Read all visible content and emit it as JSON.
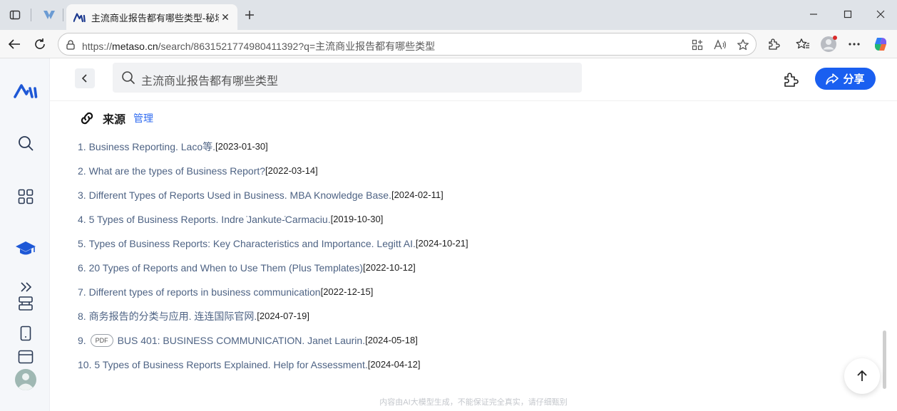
{
  "browser": {
    "tab_title": "主流商业报告都有哪些类型-秘塔AI搜索",
    "url_host": "metaso.cn",
    "url_prefix": "https://",
    "url_rest": "/search/8631521774980411392?q=主流商业报告都有哪些类型"
  },
  "header": {
    "query": "主流商业报告都有哪些类型",
    "share_label": "分享"
  },
  "sources": {
    "label": "来源",
    "manage": "管理",
    "items": [
      {
        "num": "1.",
        "title": "Business Reporting. Laco等.",
        "date": "[2023-01-30]"
      },
      {
        "num": "2.",
        "title": "What are the types of Business Report?",
        "date": "[2022-03-14]"
      },
      {
        "num": "3.",
        "title": "Different Types of Reports Used in Business. MBA Knowledge Base.",
        "date": "[2024-02-11]"
      },
      {
        "num": "4.",
        "title": "5 Types of Business Reports. Indre ̇Jankute-̇Carmaciu.",
        "date": "[2019-10-30]"
      },
      {
        "num": "5.",
        "title": "Types of Business Reports: Key Characteristics and Importance. Legitt AI.",
        "date": "[2024-10-21]"
      },
      {
        "num": "6.",
        "title": "20 Types of Reports and When to Use Them (Plus Templates)",
        "date": "[2022-10-12]"
      },
      {
        "num": "7.",
        "title": "Different types of reports in business communication",
        "date": "[2022-12-15]"
      },
      {
        "num": "8.",
        "title": "商务报告的分类与应用. 连连国际官网.",
        "date": "[2024-07-19]"
      },
      {
        "num": "9.",
        "badge": "PDF",
        "title": "BUS 401: BUSINESS COMMUNICATION. Janet Laurin.",
        "date": "[2024-05-18]"
      },
      {
        "num": "10.",
        "title": "5 Types of Business Reports Explained. Help for Assessment.",
        "date": "[2024-04-12]"
      }
    ]
  },
  "footer_note": "内容由AI大模型生成，不能保证完全真实，请仔细甄别",
  "colors": {
    "accent": "#1a5ff0",
    "link": "#4e6384",
    "manage": "#2f6bf0",
    "sidebar_bg": "#f5f7fa"
  }
}
